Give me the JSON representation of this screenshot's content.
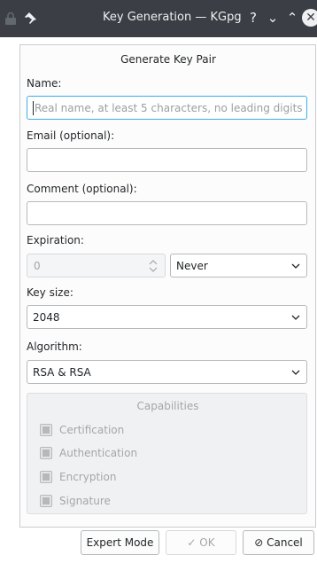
{
  "window": {
    "title": "Key Generation — KGpg",
    "help_glyph": "?",
    "minimize_glyph": "⌄",
    "maximize_glyph": "⌃",
    "close_glyph": "✕",
    "icons": [
      "lock-icon",
      "pin-icon",
      "help-icon",
      "minimize-icon",
      "maximize-icon",
      "close-icon"
    ]
  },
  "form": {
    "section_title": "Generate Key Pair",
    "name": {
      "label": "Name:",
      "value": "",
      "placeholder": "Real name, at least 5 characters, no leading digits"
    },
    "email": {
      "label": "Email (optional):",
      "value": ""
    },
    "comment": {
      "label": "Comment (optional):",
      "value": ""
    },
    "expiration": {
      "label": "Expiration:",
      "value": "0",
      "unit": "Never"
    },
    "key_size": {
      "label": "Key size:",
      "value": "2048"
    },
    "algorithm": {
      "label": "Algorithm:",
      "value": "RSA & RSA"
    },
    "capabilities": {
      "title": "Capabilities",
      "items": [
        {
          "label": "Certification",
          "checked": true
        },
        {
          "label": "Authentication",
          "checked": true
        },
        {
          "label": "Encryption",
          "checked": true
        },
        {
          "label": "Signature",
          "checked": true
        }
      ]
    }
  },
  "buttons": {
    "expert": "Expert Mode",
    "ok": "✓ OK",
    "cancel": "⊘ Cancel"
  },
  "colors": {
    "titlebar": "#3b3f45",
    "focus": "#3daee9",
    "disabled_text": "#a3a7ab"
  }
}
